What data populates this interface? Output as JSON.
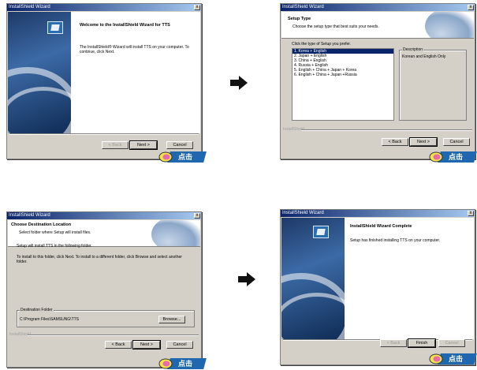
{
  "window_title": "InstallShield Wizard",
  "close_glyph": "x",
  "click_label": "点击",
  "installshield_label": "InstallShield",
  "panels": {
    "welcome": {
      "heading": "Welcome to the InstallShield Wizard for TTS",
      "body": "The InstallShield® Wizard will install TTS on your computer.  To continue, click Next.",
      "back_button": "< Back",
      "next_button": "Next >",
      "cancel_button": "Cancel"
    },
    "setup_type": {
      "heading": "Setup Type",
      "subheading": "Choose the setup type that best suits your needs.",
      "prompt": "Click the type of Setup you prefer.",
      "options": [
        "1. Korea + English",
        "2. Japan + English",
        "3. China + English",
        "4. Russia + English",
        "5. English + China + Japan + Korea",
        "6. English + China + Japan +Russia"
      ],
      "selected_index": 0,
      "description_label": "Description",
      "description_text": "Korean and English Only",
      "back_button": "< Back",
      "next_button": "Next >",
      "cancel_button": "Cancel"
    },
    "destination": {
      "heading": "Choose Destination Location",
      "subheading": "Select folder where Setup will install files.",
      "line1": "Setup will install TTS in the following folder.",
      "line2": "To install to this folder, click Next. To install to a different folder, click Browse and select another folder.",
      "folder_group_label": "Destination Folder",
      "folder_path": "C:\\Program Files\\SAMSUNG\\TTS",
      "browse_button": "Browse...",
      "back_button": "< Back",
      "next_button": "Next >",
      "cancel_button": "Cancel"
    },
    "complete": {
      "heading": "InstallShield Wizard Complete",
      "body": "Setup has finished installing TTS on your computer.",
      "back_button": "< Back",
      "finish_button": "Finish",
      "cancel_button": "Cancel"
    }
  },
  "colors": {
    "titlebar_start": "#0a246a",
    "titlebar_end": "#a6caf0",
    "dialog_bg": "#d4d0c8",
    "badge_blue": "#1f68b0",
    "arrow": "#111111"
  }
}
